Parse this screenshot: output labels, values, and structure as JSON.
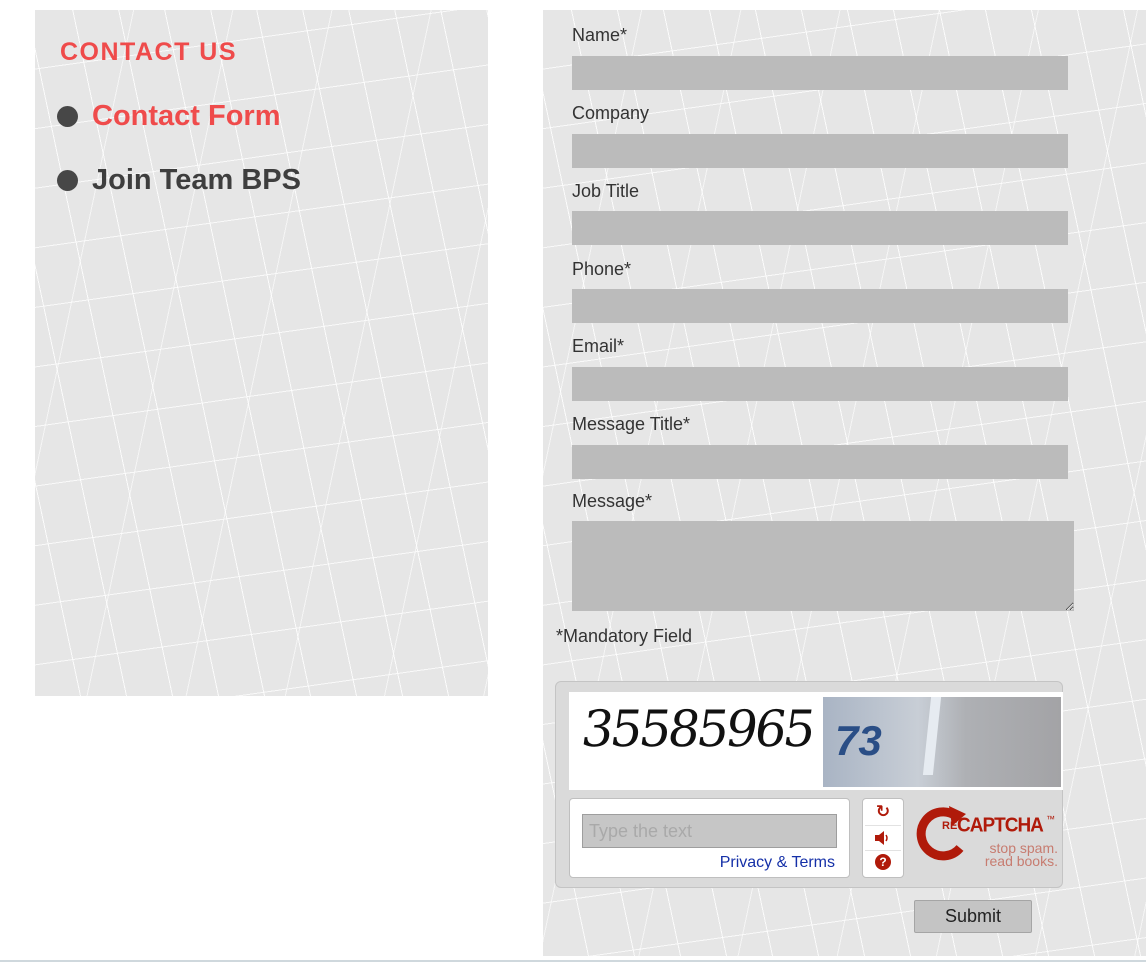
{
  "sidebar": {
    "heading": "CONTACT US",
    "items": [
      {
        "label": "Contact Form",
        "active": true
      },
      {
        "label": "Join Team BPS",
        "active": false
      }
    ]
  },
  "form": {
    "fields": {
      "name": {
        "label": "Name*",
        "value": ""
      },
      "company": {
        "label": "Company",
        "value": ""
      },
      "job_title": {
        "label": "Job Title",
        "value": ""
      },
      "phone": {
        "label": "Phone*",
        "value": ""
      },
      "email": {
        "label": "Email*",
        "value": ""
      },
      "message_title": {
        "label": "Message Title*",
        "value": ""
      },
      "message": {
        "label": "Message*",
        "value": ""
      }
    },
    "mandatory_note": "*Mandatory Field",
    "submit_label": "Submit"
  },
  "recaptcha": {
    "challenge_word": "35585965",
    "challenge_photo_text": "73",
    "input_placeholder": "Type the text",
    "privacy_link": "Privacy & Terms",
    "controls": [
      "reload-icon",
      "audio-icon",
      "help-icon"
    ],
    "logo_prefix": "RE",
    "logo_name": "CAPTCHA",
    "logo_tm": "™",
    "tagline_1": "stop spam.",
    "tagline_2": "read books."
  },
  "colors": {
    "accent": "#ef4b4b",
    "nav_text": "#3e3e3e",
    "input_bg": "#bbbbbb",
    "panel_bg": "#e6e6e6",
    "recaptcha_red": "#b01a0a",
    "link_blue": "#1530a8"
  }
}
